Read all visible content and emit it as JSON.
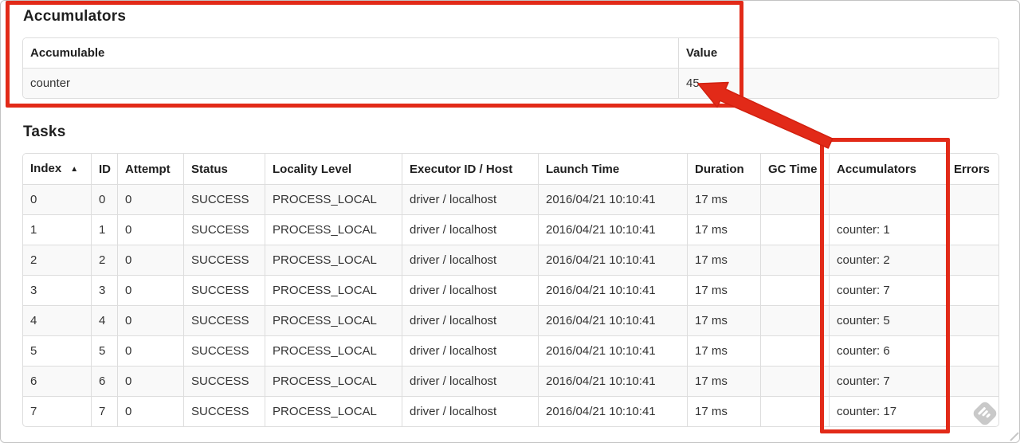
{
  "accumulators_section": {
    "title": "Accumulators",
    "columns": [
      "Accumulable",
      "Value"
    ],
    "rows": [
      [
        "counter",
        "45"
      ]
    ]
  },
  "tasks_section": {
    "title": "Tasks",
    "columns": [
      "Index",
      "ID",
      "Attempt",
      "Status",
      "Locality Level",
      "Executor ID / Host",
      "Launch Time",
      "Duration",
      "GC Time",
      "Accumulators",
      "Errors"
    ],
    "sort": {
      "column": "Index",
      "direction": "ascending",
      "icon": "▲"
    },
    "rows": [
      [
        "0",
        "0",
        "0",
        "SUCCESS",
        "PROCESS_LOCAL",
        "driver / localhost",
        "2016/04/21 10:10:41",
        "17 ms",
        "",
        "",
        ""
      ],
      [
        "1",
        "1",
        "0",
        "SUCCESS",
        "PROCESS_LOCAL",
        "driver / localhost",
        "2016/04/21 10:10:41",
        "17 ms",
        "",
        "counter: 1",
        ""
      ],
      [
        "2",
        "2",
        "0",
        "SUCCESS",
        "PROCESS_LOCAL",
        "driver / localhost",
        "2016/04/21 10:10:41",
        "17 ms",
        "",
        "counter: 2",
        ""
      ],
      [
        "3",
        "3",
        "0",
        "SUCCESS",
        "PROCESS_LOCAL",
        "driver / localhost",
        "2016/04/21 10:10:41",
        "17 ms",
        "",
        "counter: 7",
        ""
      ],
      [
        "4",
        "4",
        "0",
        "SUCCESS",
        "PROCESS_LOCAL",
        "driver / localhost",
        "2016/04/21 10:10:41",
        "17 ms",
        "",
        "counter: 5",
        ""
      ],
      [
        "5",
        "5",
        "0",
        "SUCCESS",
        "PROCESS_LOCAL",
        "driver / localhost",
        "2016/04/21 10:10:41",
        "17 ms",
        "",
        "counter: 6",
        ""
      ],
      [
        "6",
        "6",
        "0",
        "SUCCESS",
        "PROCESS_LOCAL",
        "driver / localhost",
        "2016/04/21 10:10:41",
        "17 ms",
        "",
        "counter: 7",
        ""
      ],
      [
        "7",
        "7",
        "0",
        "SUCCESS",
        "PROCESS_LOCAL",
        "driver / localhost",
        "2016/04/21 10:10:41",
        "17 ms",
        "",
        "counter: 17",
        ""
      ]
    ]
  },
  "annotations": {
    "color": "#e22a18",
    "boxes": [
      "accumulators-section",
      "accumulators-column"
    ],
    "arrow_points_to": "45"
  },
  "colors": {
    "table_border": "#dddddd",
    "stripe_row": "#f9f9f9",
    "frame_border": "#c3c3c3",
    "watermark_gray": "#c5c5c5"
  },
  "icons": {
    "sort_ascending": "▲",
    "watermark": "diamond-stripes-watermark"
  }
}
